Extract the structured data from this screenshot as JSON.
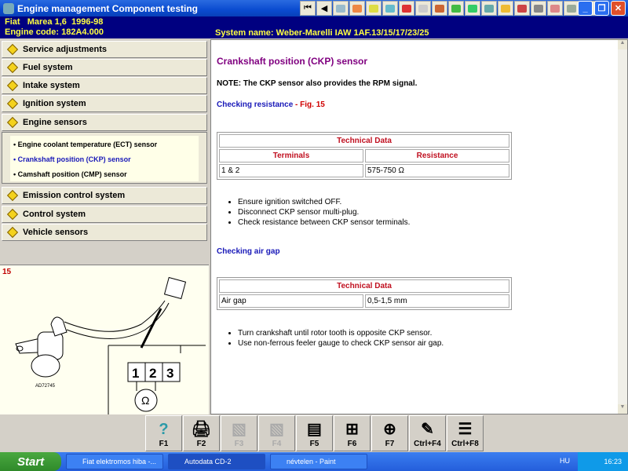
{
  "window": {
    "title": "Engine management Component testing"
  },
  "toolbar_icons": [
    "first-icon",
    "back-icon",
    "adjust-icon",
    "service-icon",
    "timing-icon",
    "repair-icon",
    "battery-icon",
    "printer-icon",
    "spark-icon",
    "fuse-icon",
    "vehicle-icon",
    "camera-icon",
    "help-icon",
    "brake-icon",
    "wheel-icon",
    "warning-icon",
    "gearbox-icon",
    "module-icon"
  ],
  "info": {
    "vehicle": "Fiat   Marea 1,6  1996-98",
    "engine_code": "Engine code: 182A4.000",
    "system_name": "System name: Weber-Marelli IAW 1AF.13/15/17/23/25"
  },
  "menu": {
    "items": [
      "Service adjustments",
      "Fuel system",
      "Intake system",
      "Ignition system",
      "Engine sensors",
      "Emission control system",
      "Control system",
      "Vehicle sensors"
    ],
    "sub_items": [
      "Engine coolant temperature (ECT) sensor",
      "Crankshaft position (CKP) sensor",
      "Camshaft position (CMP) sensor"
    ],
    "active_sub": "Crankshaft position (CKP) sensor"
  },
  "figure": {
    "number": "15",
    "ref": "AD72745",
    "terminals": [
      "1",
      "2",
      "3"
    ],
    "meter": "Ω"
  },
  "content": {
    "title": "Crankshaft position (CKP) sensor",
    "note": "NOTE: The CKP sensor also provides the RPM signal.",
    "sec1": "Checking resistance",
    "sec1_fig": " - Fig. 15",
    "table1": {
      "title": "Technical Data",
      "headers": [
        "Terminals",
        "Resistance"
      ],
      "row": [
        "1 & 2",
        "575-750 Ω"
      ]
    },
    "bullets1": [
      "Ensure ignition switched OFF.",
      "Disconnect CKP sensor multi-plug.",
      "Check resistance between CKP sensor terminals."
    ],
    "sec2": "Checking air gap",
    "table2": {
      "title": "Technical Data",
      "row": [
        "Air gap",
        "0,5-1,5 mm"
      ]
    },
    "bullets2": [
      "Turn crankshaft until rotor tooth is opposite CKP sensor.",
      "Use non-ferrous feeler gauge to check CKP sensor air gap."
    ]
  },
  "fkeys": [
    {
      "label": "F1",
      "icon": "?"
    },
    {
      "label": "F2",
      "icon": "🖨"
    },
    {
      "label": "F3",
      "icon": "▧"
    },
    {
      "label": "F4",
      "icon": "▧"
    },
    {
      "label": "F5",
      "icon": "▤"
    },
    {
      "label": "F6",
      "icon": "⊞"
    },
    {
      "label": "F7",
      "icon": "⊕"
    },
    {
      "label": "Ctrl+F4",
      "icon": "✎"
    },
    {
      "label": "Ctrl+F8",
      "icon": "☰"
    }
  ],
  "taskbar": {
    "start": "Start",
    "tasks": [
      "Fiat elektromos hiba -...",
      "Autodata CD-2",
      "névtelen - Paint"
    ],
    "lang": "HU",
    "clock": "16:23"
  },
  "colors": {
    "info_bg": "#000080",
    "info_text": "#ffff40",
    "title": "#800080",
    "link": "#1818b8",
    "table_header": "#c01020"
  }
}
